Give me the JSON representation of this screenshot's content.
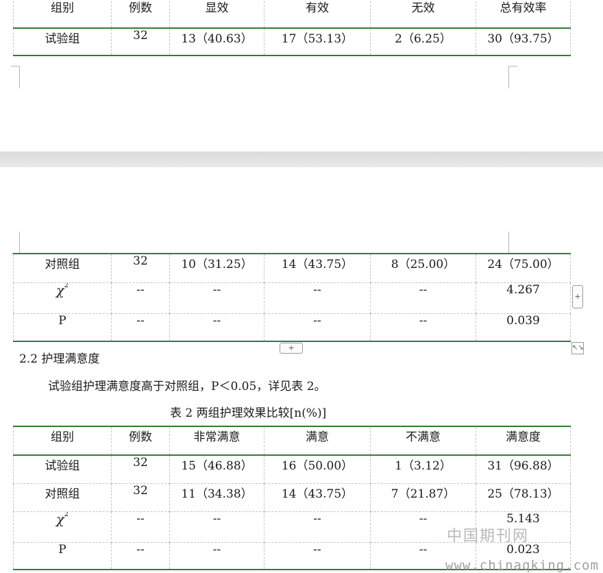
{
  "table1_top": {
    "headers": [
      "组别",
      "例数",
      "显效",
      "有效",
      "无效",
      "总有效率"
    ],
    "rows": [
      [
        "试验组",
        "32",
        "13（40.63）",
        "17（53.13）",
        "2（6.25）",
        "30（93.75）"
      ]
    ]
  },
  "table1_cont": {
    "rows": [
      [
        "对照组",
        "32",
        "10（31.25）",
        "14（43.75）",
        "8（25.00）",
        "24（75.00）"
      ],
      [
        "χ2",
        "--",
        "--",
        "--",
        "--",
        "4.267"
      ],
      [
        "P",
        "--",
        "--",
        "--",
        "--",
        "0.039"
      ]
    ]
  },
  "section": {
    "heading": "2.2 护理满意度",
    "paragraph": "试验组护理满意度高于对照组，P＜0.05，详见表 2。"
  },
  "table2": {
    "caption": "表 2 两组护理效果比较[n(%)]",
    "headers": [
      "组别",
      "例数",
      "非常满意",
      "满意",
      "不满意",
      "满意度"
    ],
    "rows": [
      [
        "试验组",
        "32",
        "15（46.88）",
        "16（50.00）",
        "1（3.12）",
        "31（96.88）"
      ],
      [
        "对照组",
        "32",
        "11（34.38）",
        "14（43.75）",
        "7（21.87）",
        "25（78.13）"
      ],
      [
        "χ2",
        "--",
        "--",
        "--",
        "--",
        "5.143"
      ],
      [
        "P",
        "--",
        "--",
        "--",
        "--",
        "0.023"
      ]
    ]
  },
  "watermark": {
    "cn": "中国期刊网",
    "url": "www.chinaqking.com"
  },
  "controls": {
    "add_symbol": "+",
    "resize_symbol": "↖↘"
  },
  "colors": {
    "rule_green": "#2e7d32",
    "grid_gray": "#c4c4c4"
  }
}
